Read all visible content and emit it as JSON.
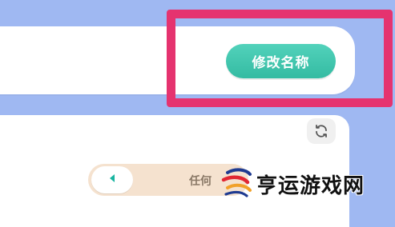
{
  "name_card": {
    "rename_label": "修改名称"
  },
  "panel": {
    "selector_text": "任何"
  },
  "watermark": {
    "text": "亨运游戏网"
  },
  "colors": {
    "background": "#9fb8f2",
    "highlight": "#e5336f",
    "button": "#3ebda7",
    "selector": "#f5e2cf"
  },
  "icons": {
    "refresh": "refresh-icon",
    "back": "triangle-left-icon",
    "logo": "brand-logo-icon"
  }
}
